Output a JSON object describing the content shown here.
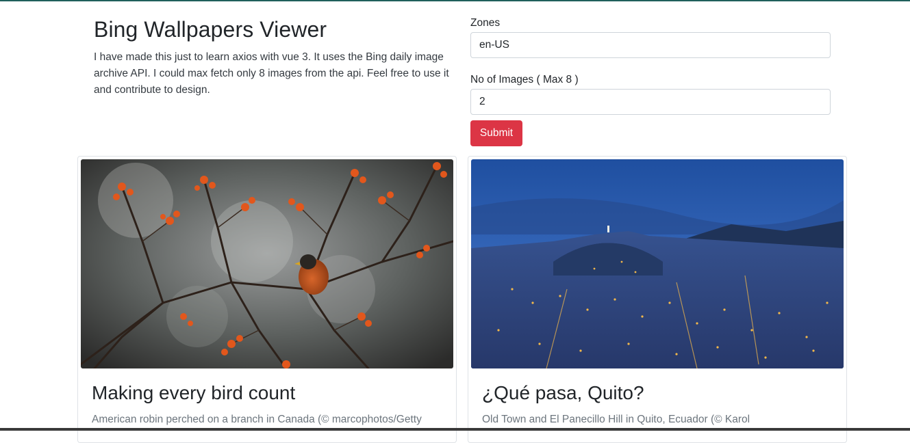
{
  "header": {
    "title": "Bing Wallpapers Viewer",
    "description": "I have made this just to learn axios with vue 3. It uses the Bing daily image archive API. I could max fetch only 8 images from the api. Feel free to use it and contribute to design."
  },
  "form": {
    "zones_label": "Zones",
    "zones_value": "en-US",
    "count_label": "No of Images ( Max 8 )",
    "count_value": "2",
    "submit_label": "Submit"
  },
  "cards": [
    {
      "title": "Making every bird count",
      "text": "American robin perched on a branch in Canada (© marcophotos/Getty",
      "image": "robin-on-berry-branch"
    },
    {
      "title": "¿Qué pasa, Quito?",
      "text": "Old Town and El Panecillo Hill in Quito, Ecuador (© Karol",
      "image": "quito-city-at-dusk"
    }
  ],
  "colors": {
    "accent": "#dc3545",
    "top_rule": "#1f5f5b"
  }
}
